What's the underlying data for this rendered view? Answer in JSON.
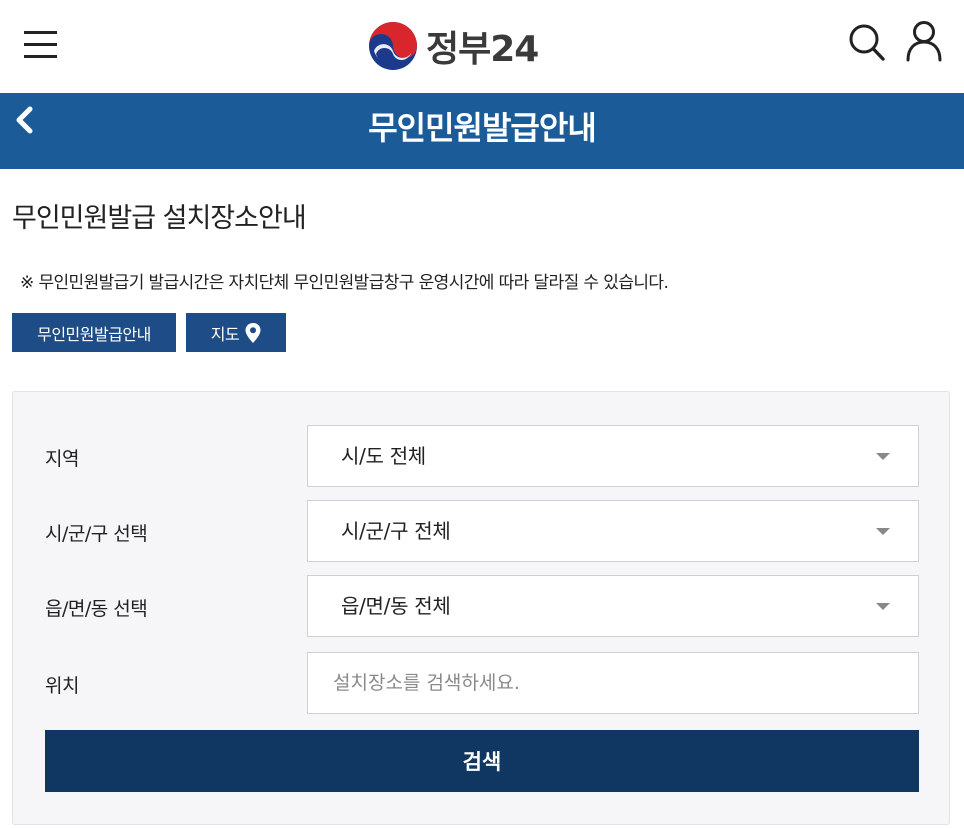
{
  "header": {
    "logo_text": "정부24",
    "logo_icon": "taegeuk-emblem-icon",
    "menu_icon": "hamburger-menu-icon",
    "search_icon": "search-icon",
    "user_icon": "user-icon"
  },
  "titlebar": {
    "title": "무인민원발급안내",
    "back_icon": "chevron-left-icon",
    "background": "#1a5b98"
  },
  "section": {
    "title": "무인민원발급 설치장소안내",
    "notice": "※ 무인민원발급기 발급시간은 자치단체 무인민원발급창구 운영시간에 따라 달라질 수 있습니다."
  },
  "tabs": [
    {
      "label": "무인민원발급안내"
    },
    {
      "label": "지도",
      "icon": "map-pin-icon"
    }
  ],
  "form": {
    "rows": [
      {
        "label": "지역",
        "value": "시/도 전체"
      },
      {
        "label": "시/군/구 선택",
        "value": "시/군/구 전체"
      },
      {
        "label": "읍/면/동 선택",
        "value": "읍/면/동 전체"
      }
    ],
    "location": {
      "label": "위치",
      "placeholder": "설치장소를 검색하세요."
    },
    "search_button": "검색"
  },
  "colors": {
    "title_bar": "#1a5b98",
    "tab_button": "#1e4c86",
    "search_button": "#0f3761",
    "panel_bg": "#f6f6f8"
  }
}
